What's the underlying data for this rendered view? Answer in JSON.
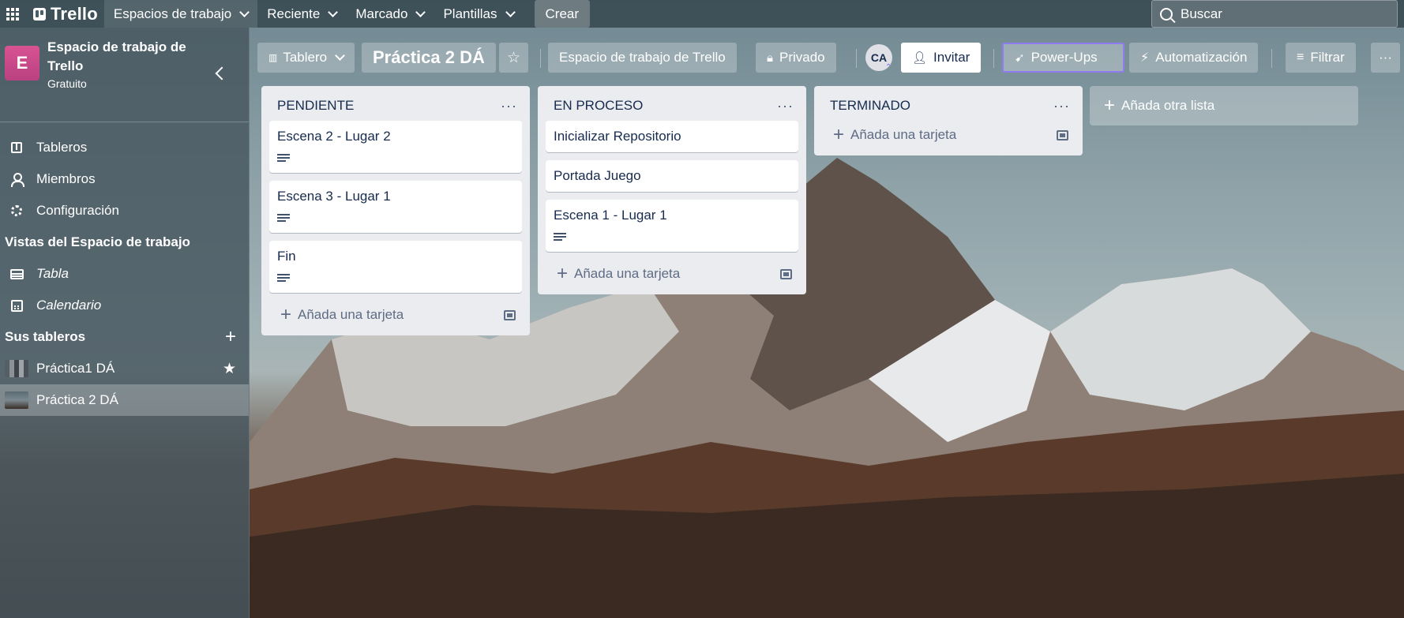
{
  "topbar": {
    "logo": "Trello",
    "nav": [
      {
        "label": "Espacios de trabajo"
      },
      {
        "label": "Reciente"
      },
      {
        "label": "Marcado"
      },
      {
        "label": "Plantillas"
      }
    ],
    "create_label": "Crear",
    "search_placeholder": "Buscar"
  },
  "sidebar": {
    "workspace_initial": "E",
    "workspace_name": "Espacio de trabajo de Trello",
    "workspace_plan": "Gratuito",
    "items": [
      {
        "label": "Tableros",
        "icon": "board-icon"
      },
      {
        "label": "Miembros",
        "icon": "person-icon"
      },
      {
        "label": "Configuración",
        "icon": "gear-icon"
      }
    ],
    "views_title": "Vistas del Espacio de trabajo",
    "views": [
      {
        "label": "Tabla",
        "icon": "table-icon"
      },
      {
        "label": "Calendario",
        "icon": "calendar-icon"
      }
    ],
    "boards_title": "Sus tableros",
    "boards": [
      {
        "label": "Práctica1 DÁ",
        "starred": true
      },
      {
        "label": "Práctica 2 DÁ",
        "active": true
      }
    ]
  },
  "board_header": {
    "view_label": "Tablero",
    "board_title": "Práctica 2 DÁ",
    "workspace_label": "Espacio de trabajo de Trello",
    "visibility_label": "Privado",
    "member_initials": "CA",
    "invite_label": "Invitar",
    "powerups_label": "Power-Ups",
    "automation_label": "Automatización",
    "filter_label": "Filtrar",
    "more_label": "···"
  },
  "lists": [
    {
      "title": "PENDIENTE",
      "cards": [
        {
          "title": "Escena 2 - Lugar 2",
          "has_description": true
        },
        {
          "title": "Escena 3 - Lugar 1",
          "has_description": true
        },
        {
          "title": "Fin",
          "has_description": true
        }
      ],
      "add_card": "Añada una tarjeta"
    },
    {
      "title": "EN PROCESO",
      "cards": [
        {
          "title": "Inicializar Repositorio",
          "has_description": false
        },
        {
          "title": "Portada Juego",
          "has_description": false
        },
        {
          "title": "Escena 1 - Lugar 1",
          "has_description": true
        }
      ],
      "add_card": "Añada una tarjeta"
    },
    {
      "title": "TERMINADO",
      "cards": [],
      "add_card": "Añada una tarjeta"
    }
  ],
  "add_list_label": "Añada otra lista",
  "colors": {
    "workspace_avatar": "#c9488a",
    "powerups_border": "#8e7cf0",
    "list_bg": "#ebecf0"
  }
}
